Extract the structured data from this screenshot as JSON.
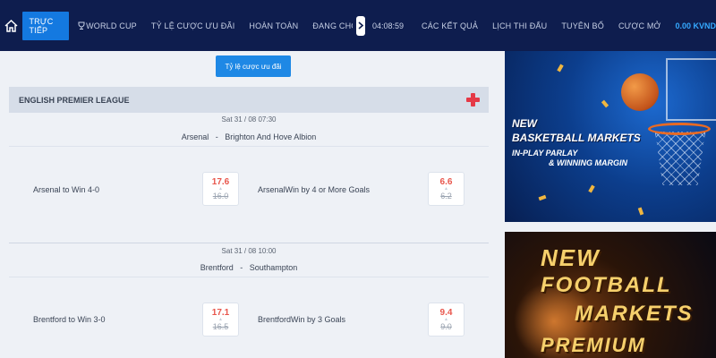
{
  "nav": {
    "live": "TRỰC TIẾP",
    "items": [
      "WORLD CUP",
      "TỶ LỆ CƯỢC ƯU ĐÃI",
      "HOÀN TOÀN",
      "ĐANG CHƠI N"
    ],
    "time": "04:08:59",
    "items2": [
      "CÁC KẾT QUẢ",
      "LỊCH THI ĐẤU",
      "TUYÊN BỐ",
      "CƯỢC MỞ"
    ],
    "balance": "0.00 KVND",
    "icons": [
      "home-icon",
      "trophy-icon",
      "chevron-right-icon"
    ]
  },
  "main": {
    "odds_button": "Tỷ lệ cược ưu đãi",
    "league": "ENGLISH PREMIER LEAGUE",
    "matches": [
      {
        "date": "Sat 31 / 08 07:30",
        "home": "Arsenal",
        "sep": "-",
        "away": "Brighton And Hove Albion",
        "bets": [
          {
            "label": "Arsenal to Win 4-0",
            "new": "17.6",
            "old": "16.0"
          },
          {
            "label": "ArsenalWin by 4 or More Goals",
            "new": "6.6",
            "old": "6.2"
          }
        ]
      },
      {
        "date": "Sat 31 / 08 10:00",
        "home": "Brentford",
        "sep": "-",
        "away": "Southampton",
        "bets": [
          {
            "label": "Brentford to Win 3-0",
            "new": "17.1",
            "old": "16.5"
          },
          {
            "label": "BrentfordWin by 3 Goals",
            "new": "9.4",
            "old": "9.0"
          }
        ]
      }
    ]
  },
  "banners": {
    "b1_title_1": "NEW",
    "b1_title_2": "BASKETBALL MARKETS",
    "b1_sub_1": "IN-PLAY PARLAY",
    "b1_sub_2": "& WINNING MARGIN",
    "b2_line_1": "NEW",
    "b2_line_2": "FOOTBALL",
    "b2_line_3": "MARKETS",
    "b2_line_4": "PREMIUM"
  },
  "colors": {
    "nav_bg": "#0e1d4e",
    "accent": "#1479e0",
    "odd_up": "#e8564c",
    "balance": "#35a9ff"
  }
}
